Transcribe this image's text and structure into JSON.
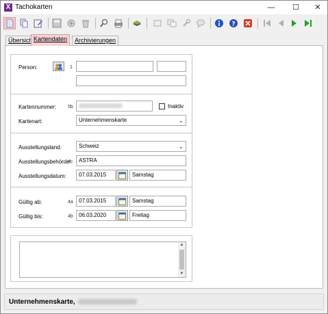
{
  "window": {
    "title": "Tachokarten",
    "app_icon": "X",
    "minimize": "—",
    "maximize": "☐",
    "close": "✕"
  },
  "toolbar": {
    "buttons": [
      "new-document-icon",
      "copy-icon",
      "edit-icon",
      "save-icon",
      "save-all-icon",
      "delete-icon",
      "search-icon",
      "print-icon",
      "stack-icon",
      "window-icon",
      "window-copy-icon",
      "tools-icon",
      "comment-icon",
      "info-icon",
      "help-icon",
      "exit-icon",
      "first-record-icon",
      "previous-record-icon",
      "next-record-icon",
      "last-record-icon"
    ],
    "active_button": "new-document-icon"
  },
  "tabs": [
    {
      "label": "Übersicht",
      "active": false
    },
    {
      "label": "Kartendaten",
      "active": true
    },
    {
      "label": "Archivierungen",
      "active": false
    }
  ],
  "form": {
    "person": {
      "label": "Person:",
      "code": "1",
      "value_first": "",
      "value_second": "",
      "value_third": ""
    },
    "kartennummer": {
      "label": "Kartennummer:",
      "code": "5b",
      "value": ""
    },
    "inaktiv": {
      "label": "Inaktiv",
      "checked": false
    },
    "kartenart": {
      "label": "Kartenart:",
      "value": "Unternehmenskarte"
    },
    "ausstellungsland": {
      "label": "Ausstellungsland:",
      "value": "Schweiz"
    },
    "ausstellungsbehoerde": {
      "label": "Ausstellungsbehörde:",
      "code": "4c",
      "value": "ASTRA"
    },
    "ausstellungsdatum": {
      "label": "Ausstellungsdatum:",
      "date": "07.03.2015",
      "weekday": "Samstag"
    },
    "gueltig_ab": {
      "label": "Gültig ab:",
      "code": "4a",
      "date": "07.03.2015",
      "weekday": "Samstag"
    },
    "gueltig_bis": {
      "label": "Gültig bis:",
      "code": "4b",
      "date": "06.03.2020",
      "weekday": "Freitag"
    }
  },
  "notes": {
    "value": ""
  },
  "status": {
    "text": "Unternehmenskarte,"
  },
  "colors": {
    "active_highlight": "#f7c6cb",
    "info_blue": "#1a56c8",
    "exit_red": "#d63a2a",
    "nav_green": "#22a02a",
    "app_purple": "#6b2d8e"
  }
}
